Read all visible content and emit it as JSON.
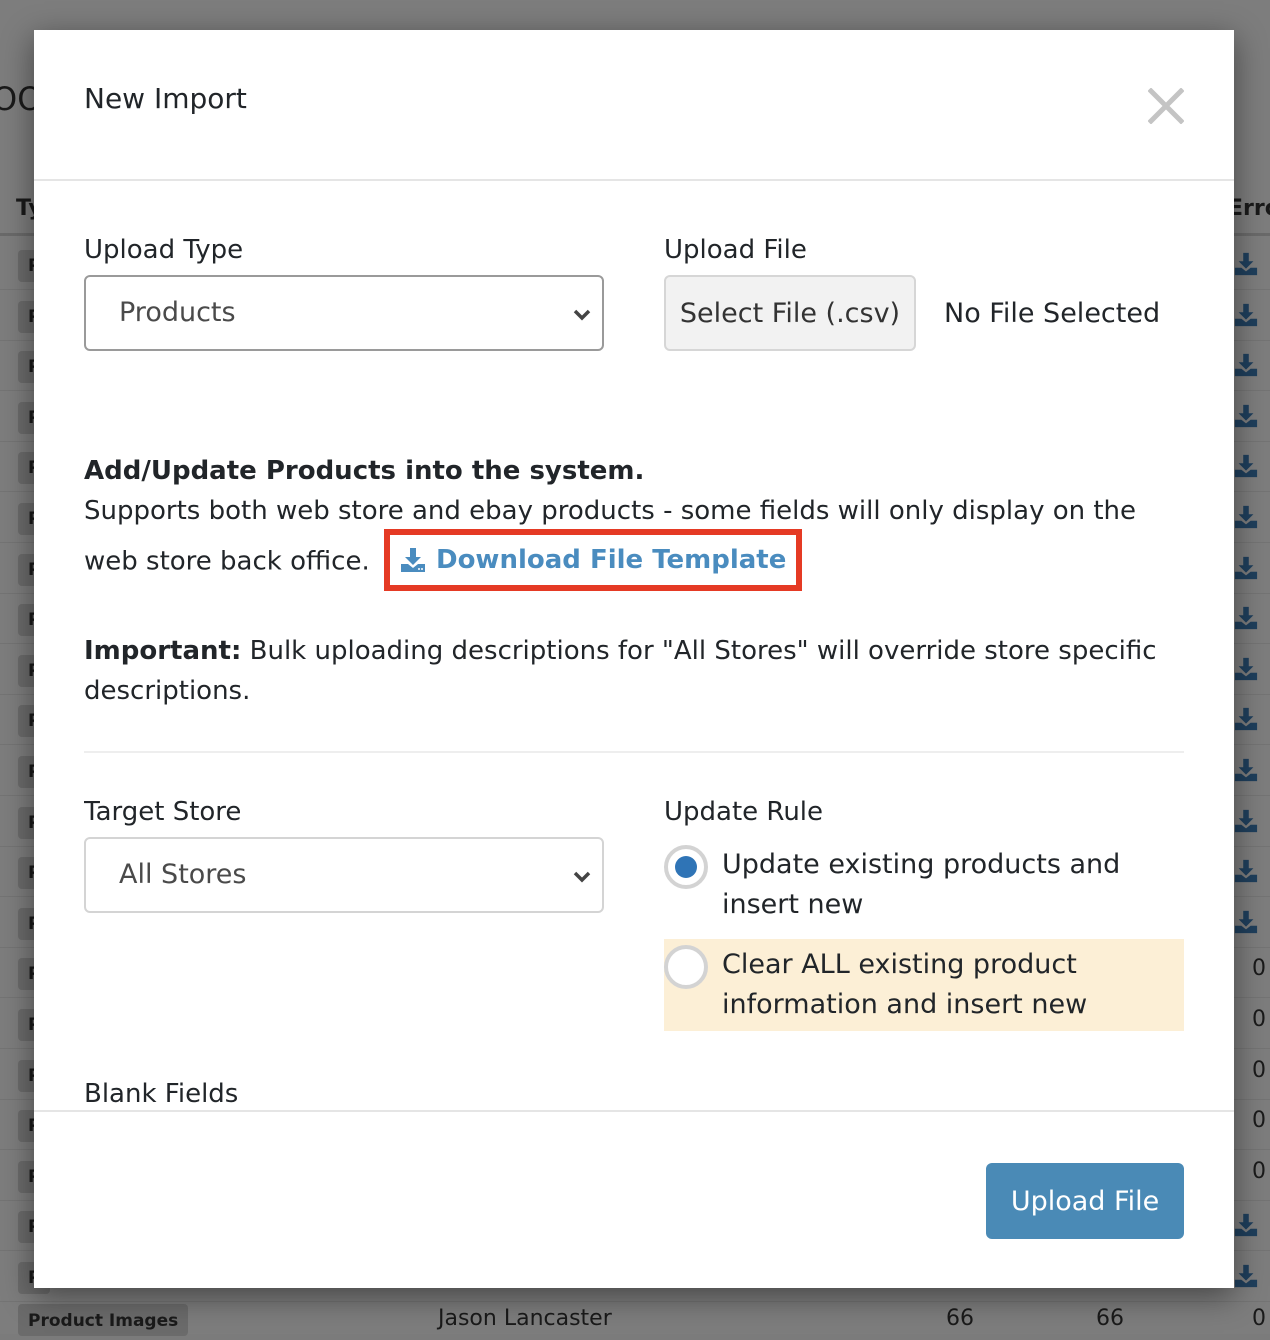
{
  "background": {
    "page_title_fragment": "OO",
    "table": {
      "type_header": "Ty",
      "errors_header": "Erro",
      "row_badge_fragment": "P",
      "rows": [
        {
          "type": "P",
          "errors": "download"
        },
        {
          "type": "P",
          "errors": "download"
        },
        {
          "type": "P",
          "errors": "download"
        },
        {
          "type": "P",
          "errors": "download"
        },
        {
          "type": "P",
          "errors": "download"
        },
        {
          "type": "P",
          "errors": "download"
        },
        {
          "type": "P",
          "errors": "download"
        },
        {
          "type": "P",
          "errors": "download"
        },
        {
          "type": "P",
          "errors": "download"
        },
        {
          "type": "P",
          "errors": "download"
        },
        {
          "type": "P",
          "errors": "download"
        },
        {
          "type": "P",
          "errors": "download"
        },
        {
          "type": "P",
          "errors": "download"
        },
        {
          "type": "P",
          "errors": "download"
        },
        {
          "type": "P",
          "errors": "0"
        },
        {
          "type": "P",
          "errors": "0"
        },
        {
          "type": "P",
          "errors": "0"
        },
        {
          "type": "P",
          "errors": "0"
        },
        {
          "type": "P",
          "errors": "0"
        },
        {
          "type": "P",
          "errors": "download"
        },
        {
          "type": "P",
          "errors": "download"
        }
      ],
      "last_row": {
        "type": "Product Images",
        "user": "Jason Lancaster",
        "col_a": "66",
        "col_b": "66",
        "errors": "0"
      }
    }
  },
  "modal": {
    "title": "New Import",
    "close_icon": "close-icon",
    "upload_type": {
      "label": "Upload Type",
      "selected": "Products"
    },
    "upload_file": {
      "label": "Upload File",
      "button_label": "Select File (.csv)",
      "status": "No File Selected"
    },
    "description": {
      "heading": "Add/Update Products into the system.",
      "text": "Supports both web store and ebay products - some fields will only display on the web store back office.",
      "download_link": "Download File Template",
      "download_icon": "download-icon"
    },
    "important": {
      "label": "Important:",
      "text": " Bulk uploading descriptions for \"All Stores\" will override store specific descriptions."
    },
    "target_store": {
      "label": "Target Store",
      "selected": "All Stores"
    },
    "update_rule": {
      "label": "Update Rule",
      "options": [
        {
          "label": "Update existing products and insert new",
          "checked": true
        },
        {
          "label": "Clear ALL existing product information and insert new",
          "checked": false
        }
      ]
    },
    "blank_fields": {
      "label": "Blank Fields"
    },
    "footer": {
      "upload_button": "Upload File"
    }
  },
  "colors": {
    "link": "#4a8cbf",
    "primary_button": "#4a8ab6",
    "radio_checked": "#2f74b6",
    "highlight_border": "#e53a24",
    "warning_bg": "#fcefd6"
  }
}
